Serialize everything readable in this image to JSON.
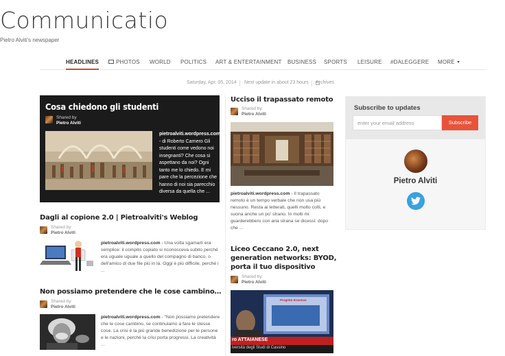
{
  "site": {
    "title": "Communicatio",
    "subtitle": "Pietro Alviti's newspaper"
  },
  "nav": {
    "items": [
      {
        "label": "HEADLINES",
        "active": true
      },
      {
        "label": "PHOTOS",
        "icon": "photo-icon"
      },
      {
        "label": "WORLD"
      },
      {
        "label": "POLITICS"
      },
      {
        "label": "ART & ENTERTAINMENT"
      },
      {
        "label": "BUSINESS"
      },
      {
        "label": "SPORTS"
      },
      {
        "label": "LEISURE"
      },
      {
        "label": "#DALEGGERE"
      },
      {
        "label": "MORE",
        "icon": "caret-down-icon"
      }
    ]
  },
  "dateline": {
    "date": "Saturday, Apr. 05, 2014",
    "next_update": "Next update in about 23 hours",
    "archives": "Archives"
  },
  "featured": {
    "title": "Cosa chiedono gli studenti",
    "shared_label": "Shared by",
    "shared_name": "Pietro Alviti",
    "source": "pietroalviti.wordpress.com",
    "snippet": " - di Roberto Carnero Gli studenti come vedono noi insegnanti? Che cosa si aspettano da noi? Ogni tanto me lo chiedo. E mi pare che la percezione che hanno di noi sia parecchio diversa da quella che ..."
  },
  "articles_left": [
    {
      "title": "Dagli al copione 2.0 | Pietroalviti's Weblog",
      "shared_label": "Shared by",
      "shared_name": "Pietro Alviti",
      "source": "pietroalviti.wordpress.com",
      "snippet": " - Una volta sgamarli era semplice: il compito copiato si riconosceva subito perché era uguale uguale a quello del compagno di banco, o dell'amico di due file più in là. Oggi è più difficile, perché i ..."
    },
    {
      "title": "Non possiamo pretendere che le cose cambino…",
      "shared_label": "Shared by",
      "shared_name": "Pietro Alviti",
      "source": "pietroalviti.wordpress.com",
      "snippet": " - \"Non possiamo pretendere che le cose cambino, se continuiamo a fare le stesse cose. La crisi è la più grande benedizione per le persone e le nazioni, perché la crisi porta progressi. La creatività ..."
    }
  ],
  "articles_right": [
    {
      "title": "Ucciso il trapassato remoto",
      "shared_label": "Shared by",
      "shared_name": "Pietro Alviti",
      "source": "pietroalviti.wordpress.com",
      "snippet": " - Il trapassato remoto è un tempo verbale che non usa più nessuno. Resta ai letterati, quelli molto colti, e suona anche un po' strano. In molti mi guarderebbero con aria strana se dicessi: dopo che ..."
    },
    {
      "title_lines": [
        "Liceo Ceccano 2.0, next",
        "generation networks: BYOD,",
        "porta il tuo dispositivo"
      ],
      "shared_label": "Shared by",
      "shared_name": "Pietro Alviti",
      "thumb_text_1": "Progetto Erasmus",
      "thumb_text_2": "ro ATTAIANESE",
      "thumb_text_3": "iversità degli Studi di Cassino"
    }
  ],
  "sidebar": {
    "title": "Subscribe to updates",
    "email_placeholder": "enter your email address",
    "subscribe_label": "Subscribe",
    "name": "Pietro Alviti"
  },
  "colors": {
    "accent": "#e9533a",
    "twitter": "#3aa1e0",
    "featured_bg": "#1b1b1b"
  }
}
